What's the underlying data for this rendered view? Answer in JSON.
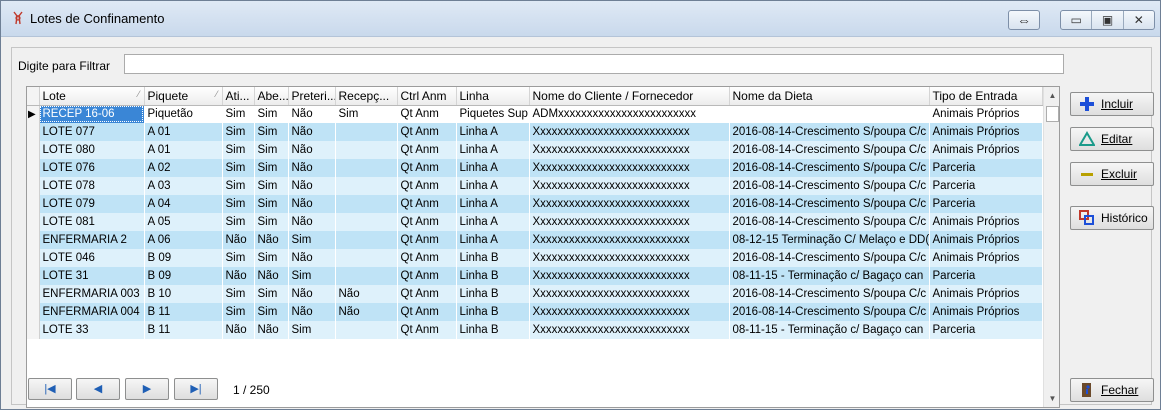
{
  "window": {
    "title": "Lotes de Confinamento"
  },
  "filter": {
    "label": "Digite para Filtrar",
    "value": ""
  },
  "columns": [
    "Lote",
    "Piquete",
    "Ati...",
    "Abe...",
    "Preteri...",
    "Recepç...",
    "Ctrl Anm",
    "Linha",
    "Nome do Cliente / Fornecedor",
    "Nome da Dieta",
    "Tipo de Entrada"
  ],
  "rows": [
    [
      "RECEP 16-06",
      "Piquetão",
      "Sim",
      "Sim",
      "Não",
      "Sim",
      "Qt Anm",
      "Piquetes Sup",
      "ADMxxxxxxxxxxxxxxxxxxxxxxxx",
      "",
      "Animais Próprios"
    ],
    [
      "LOTE 077",
      "A 01",
      "Sim",
      "Sim",
      "Não",
      "",
      "Qt Anm",
      "Linha A",
      "Xxxxxxxxxxxxxxxxxxxxxxxxxxx",
      "2016-08-14-Crescimento S/poupa C/c",
      "Animais Próprios"
    ],
    [
      "LOTE 080",
      "A 01",
      "Sim",
      "Sim",
      "Não",
      "",
      "Qt Anm",
      "Linha A",
      "Xxxxxxxxxxxxxxxxxxxxxxxxxxx",
      "2016-08-14-Crescimento S/poupa C/c",
      "Animais Próprios"
    ],
    [
      "LOTE 076",
      "A 02",
      "Sim",
      "Sim",
      "Não",
      "",
      "Qt Anm",
      "Linha A",
      "Xxxxxxxxxxxxxxxxxxxxxxxxxxx",
      "2016-08-14-Crescimento S/poupa C/c",
      "Parceria"
    ],
    [
      "LOTE 078",
      "A 03",
      "Sim",
      "Sim",
      "Não",
      "",
      "Qt Anm",
      "Linha A",
      "Xxxxxxxxxxxxxxxxxxxxxxxxxxx",
      "2016-08-14-Crescimento S/poupa C/c",
      "Parceria"
    ],
    [
      "LOTE 079",
      "A 04",
      "Sim",
      "Sim",
      "Não",
      "",
      "Qt Anm",
      "Linha A",
      "Xxxxxxxxxxxxxxxxxxxxxxxxxxx",
      "2016-08-14-Crescimento S/poupa C/c",
      "Parceria"
    ],
    [
      "LOTE 081",
      "A 05",
      "Sim",
      "Sim",
      "Não",
      "",
      "Qt Anm",
      "Linha A",
      "Xxxxxxxxxxxxxxxxxxxxxxxxxxx",
      "2016-08-14-Crescimento S/poupa C/c",
      "Animais Próprios"
    ],
    [
      "ENFERMARIA 2",
      "A 06",
      "Não",
      "Não",
      "Sim",
      "",
      "Qt Anm",
      "Linha A",
      "Xxxxxxxxxxxxxxxxxxxxxxxxxxx",
      "08-12-15 Terminação C/ Melaço e DD(",
      "Animais Próprios"
    ],
    [
      "LOTE 046",
      "B 09",
      "Sim",
      "Sim",
      "Não",
      "",
      "Qt Anm",
      "Linha B",
      "Xxxxxxxxxxxxxxxxxxxxxxxxxxx",
      "2016-08-14-Crescimento S/poupa C/c",
      "Animais Próprios"
    ],
    [
      "LOTE 31",
      "B 09",
      "Não",
      "Não",
      "Sim",
      "",
      "Qt Anm",
      "Linha B",
      "Xxxxxxxxxxxxxxxxxxxxxxxxxxx",
      "08-11-15 - Terminação c/ Bagaço can",
      "Parceria"
    ],
    [
      "ENFERMARIA 003",
      "B 10",
      "Sim",
      "Sim",
      "Não",
      "Não",
      "Qt Anm",
      "Linha B",
      "Xxxxxxxxxxxxxxxxxxxxxxxxxxx",
      "2016-08-14-Crescimento S/poupa C/c",
      "Animais Próprios"
    ],
    [
      "ENFERMARIA 004",
      "B 11",
      "Sim",
      "Sim",
      "Não",
      "Não",
      "Qt Anm",
      "Linha B",
      "Xxxxxxxxxxxxxxxxxxxxxxxxxxx",
      "2016-08-14-Crescimento S/poupa C/c",
      "Animais Próprios"
    ],
    [
      "LOTE 33",
      "B 11",
      "Não",
      "Não",
      "Sim",
      "",
      "Qt Anm",
      "Linha B",
      "Xxxxxxxxxxxxxxxxxxxxxxxxxxx",
      "08-11-15 - Terminação c/ Bagaço can",
      "Parceria"
    ]
  ],
  "buttons": {
    "incluir": "Incluir",
    "editar": "Editar",
    "excluir": "Excluir",
    "historico": "Histórico",
    "fechar": "Fechar"
  },
  "pager": {
    "count": "1 / 250"
  },
  "colors": {
    "row_dark": "#bfe3f6",
    "row_light": "#def1fb",
    "selected": "#3a86d6"
  }
}
